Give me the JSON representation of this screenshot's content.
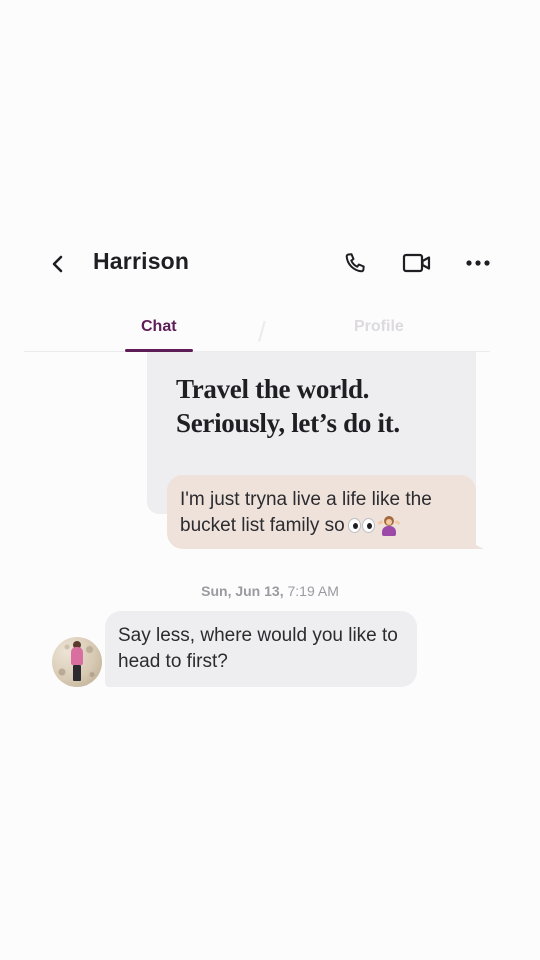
{
  "header": {
    "contact_name": "Harrison"
  },
  "tabs": [
    {
      "label": "Chat",
      "active": true
    },
    {
      "label": "Profile",
      "active": false
    }
  ],
  "prompt_card": {
    "line1": "Travel the world.",
    "line2": "Seriously, let’s do it."
  },
  "messages": {
    "sent": {
      "text": "I'm just tryna live a life like the bucket list family so"
    },
    "timestamp": {
      "date": "Sun, Jun 13,",
      "time": "7:19 AM"
    },
    "received": {
      "text": "Say less, where would you like to head to first?"
    }
  },
  "icons": {
    "back": "chevron-left-icon",
    "call": "phone-icon",
    "video": "video-camera-icon",
    "more": "more-horizontal-icon",
    "emoji_1": "eyes-emoji",
    "emoji_2": "person-shrugging-emoji"
  },
  "colors": {
    "accent": "#5e1d57",
    "sent_bubble": "#eee2da",
    "received_bubble": "#eeedf0",
    "prompt_card": "#eeedf0",
    "inactive_tab": "#dcdade",
    "timestamp": "#9a9aa0"
  }
}
